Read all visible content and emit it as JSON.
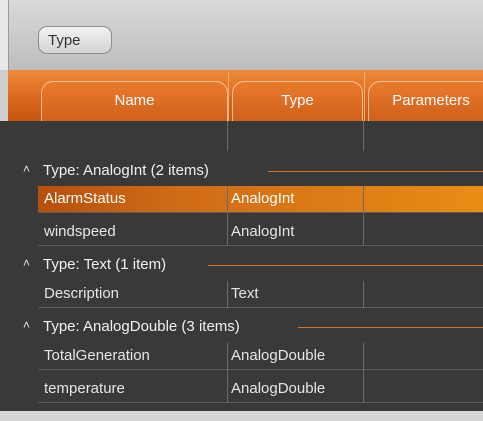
{
  "group_panel": {
    "chip_label": "Type"
  },
  "columns": [
    "Name",
    "Type",
    "Parameters"
  ],
  "groups": [
    {
      "label": "Type: AnalogInt (2 items)",
      "rows": [
        {
          "name": "AlarmStatus",
          "type": "AnalogInt",
          "selected": true
        },
        {
          "name": "windspeed",
          "type": "AnalogInt",
          "selected": false
        }
      ]
    },
    {
      "label": "Type: Text (1 item)",
      "rows": [
        {
          "name": "Description",
          "type": "Text",
          "selected": false
        }
      ]
    },
    {
      "label": "Type: AnalogDouble (3 items)",
      "rows": [
        {
          "name": "TotalGeneration",
          "type": "AnalogDouble",
          "selected": false
        },
        {
          "name": "temperature",
          "type": "AnalogDouble",
          "selected": false
        }
      ]
    }
  ],
  "colors": {
    "accent": "#e2721f",
    "selection": "#ea8c14",
    "grid_background": "#393939"
  },
  "icons": {
    "group_toggle": "chevron-up-icon"
  }
}
